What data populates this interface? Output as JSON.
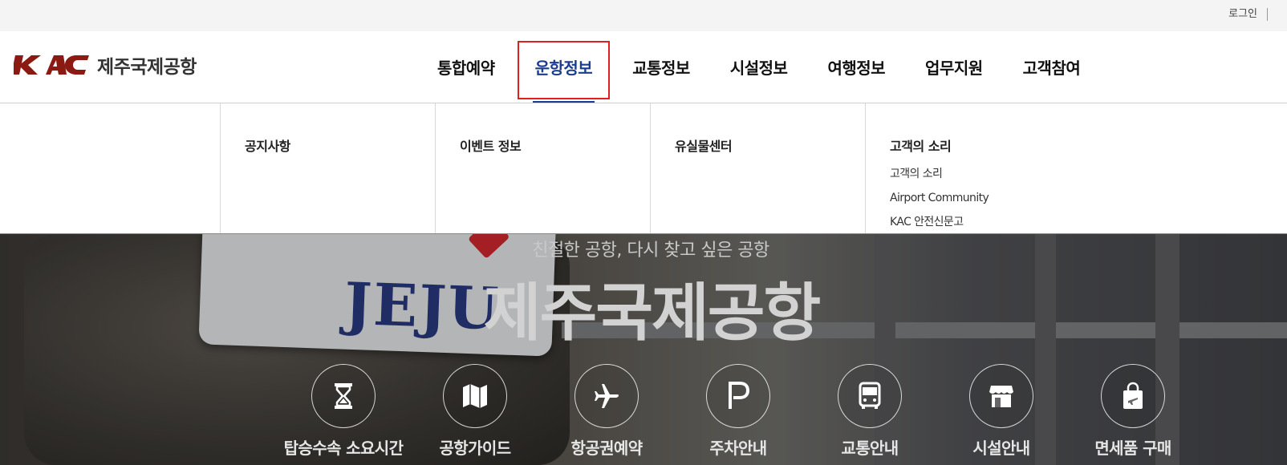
{
  "util": {
    "login": "로그인"
  },
  "header": {
    "logo_mark": "KAC",
    "logo_text": "제주국제공항",
    "brand_color": "#8b1a12",
    "menu": [
      "통합예약",
      "운항정보",
      "교통정보",
      "시설정보",
      "여행정보",
      "업무지원",
      "고객참여"
    ],
    "active_menu": "운항정보"
  },
  "dropdown": {
    "columns": [
      {
        "title": "공지사항",
        "items": []
      },
      {
        "title": "이벤트 정보",
        "items": []
      },
      {
        "title": "유실물센터",
        "items": []
      },
      {
        "title": "고객의 소리",
        "items": [
          "고객의 소리",
          "Airport Community",
          "KAC 안전신문고"
        ]
      }
    ]
  },
  "hero": {
    "subtitle": "친절한 공항, 다시 찾고 싶은 공항",
    "title": "제주국제공항",
    "sign_text": "JEJU",
    "quick_links": [
      {
        "label": "탑승수속 소요시간",
        "icon": "hourglass-icon"
      },
      {
        "label": "공항가이드",
        "icon": "map-icon"
      },
      {
        "label": "항공권예약",
        "icon": "airplane-icon"
      },
      {
        "label": "주차안내",
        "icon": "parking-icon"
      },
      {
        "label": "교통안내",
        "icon": "bus-icon"
      },
      {
        "label": "시설안내",
        "icon": "store-icon"
      },
      {
        "label": "면세품 구매",
        "icon": "shopping-bag-icon"
      }
    ]
  }
}
